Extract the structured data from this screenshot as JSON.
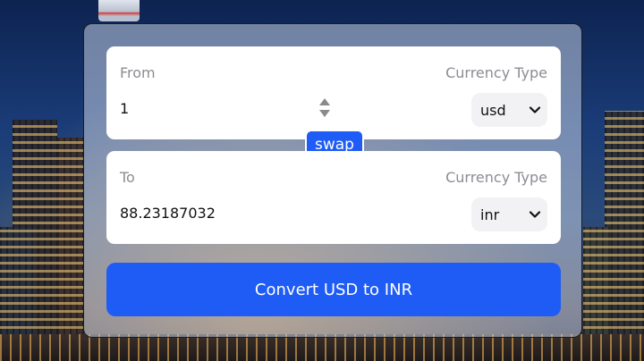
{
  "from_panel": {
    "label": "From",
    "currency_type_label": "Currency Type",
    "amount_value": "1",
    "currency_selected": "usd"
  },
  "to_panel": {
    "label": "To",
    "currency_type_label": "Currency Type",
    "amount_value": "88.23187032",
    "currency_selected": "inr"
  },
  "swap_label": "swap",
  "convert_label": "Convert USD to INR",
  "colors": {
    "accent": "#1f5cf5",
    "panel": "#ffffff",
    "label_text": "#8c8c94"
  },
  "icons": {
    "spinner": "spinner-arrows-icon",
    "select": "chevron-down-icon"
  }
}
